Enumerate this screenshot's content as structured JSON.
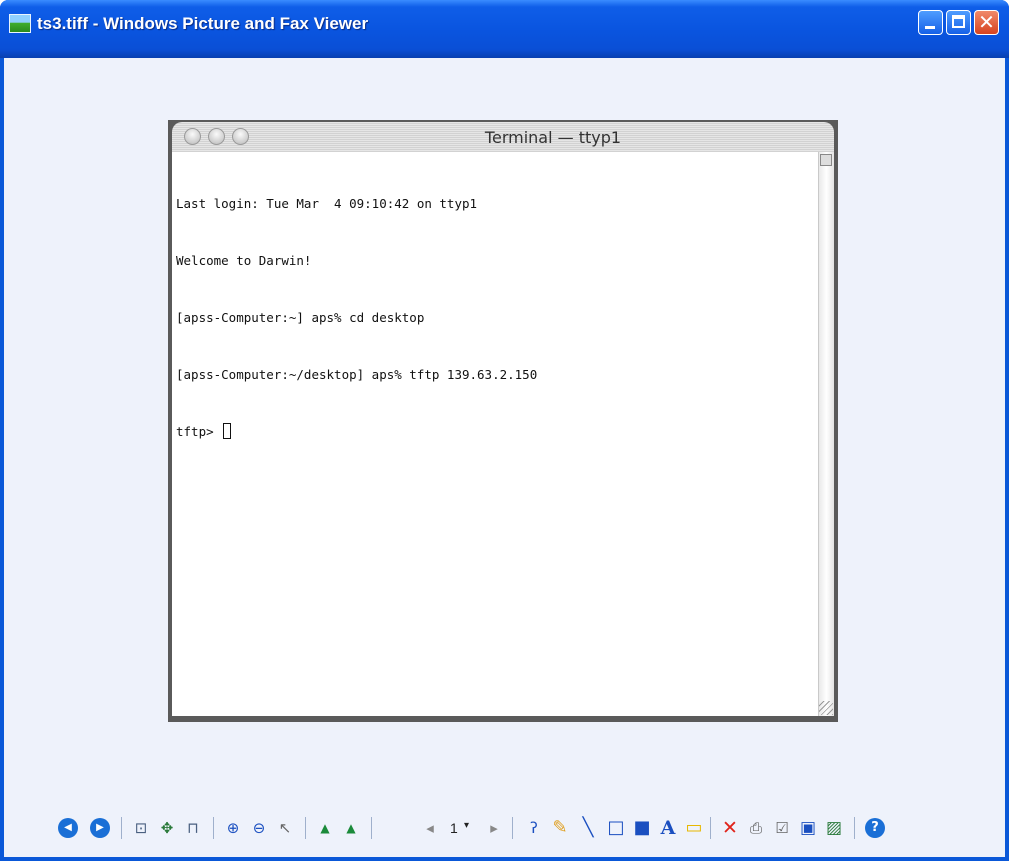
{
  "window": {
    "title": "ts3.tiff - Windows Picture and Fax Viewer",
    "icon": "picture-icon",
    "controls": {
      "minimize": "minimize-icon",
      "maximize": "maximize-icon",
      "close": "close-icon",
      "close_glyph": "✕"
    }
  },
  "image": {
    "terminal_title": "Terminal — ttyp1",
    "lines": [
      "Last login: Tue Mar  4 09:10:42 on ttyp1",
      "Welcome to Darwin!",
      "[apss-Computer:~] aps% cd desktop",
      "[apss-Computer:~/desktop] aps% tftp 139.63.2.150",
      "tftp> "
    ]
  },
  "toolbar": {
    "page_number": "1",
    "dropdown_glyph": "▾",
    "buttons": [
      {
        "name": "previous-image-icon",
        "glyph": "◀"
      },
      {
        "name": "next-image-icon",
        "glyph": "▶"
      },
      {
        "name": "best-fit-icon",
        "glyph": "⊡"
      },
      {
        "name": "actual-size-icon",
        "glyph": "✥"
      },
      {
        "name": "slideshow-icon",
        "glyph": "⊓"
      },
      {
        "name": "zoom-in-icon",
        "glyph": "⊕"
      },
      {
        "name": "zoom-out-icon",
        "glyph": "⊖"
      },
      {
        "name": "pointer-icon",
        "glyph": "↖"
      },
      {
        "name": "rotate-clockwise-icon",
        "glyph": "▲"
      },
      {
        "name": "rotate-counterclockwise-icon",
        "glyph": "▲"
      },
      {
        "name": "previous-page-icon",
        "glyph": "◂"
      },
      {
        "name": "next-page-icon",
        "glyph": "▸"
      },
      {
        "name": "freehand-annotation-icon",
        "glyph": "ʔ"
      },
      {
        "name": "highlighter-icon",
        "glyph": "✎"
      },
      {
        "name": "line-icon",
        "glyph": "╲"
      },
      {
        "name": "hollow-rectangle-icon",
        "glyph": "□"
      },
      {
        "name": "filled-rectangle-icon",
        "glyph": "■"
      },
      {
        "name": "text-annotation-icon",
        "glyph": "A"
      },
      {
        "name": "sticky-note-icon",
        "glyph": "▭"
      },
      {
        "name": "delete-icon",
        "glyph": "✕"
      },
      {
        "name": "print-icon",
        "glyph": "⎙"
      },
      {
        "name": "copy-to-icon",
        "glyph": "☑"
      },
      {
        "name": "save-icon",
        "glyph": "▣"
      },
      {
        "name": "edit-icon",
        "glyph": "▨"
      },
      {
        "name": "help-icon",
        "glyph": "?"
      }
    ]
  },
  "colors": {
    "titlebar": "#0a55e0",
    "client_background": "#eef2fb",
    "nav_button": "#1a6fd6",
    "delete": "#e0241b",
    "annotation_blue": "#1a4fc0",
    "highlighter": "#e0a020"
  }
}
